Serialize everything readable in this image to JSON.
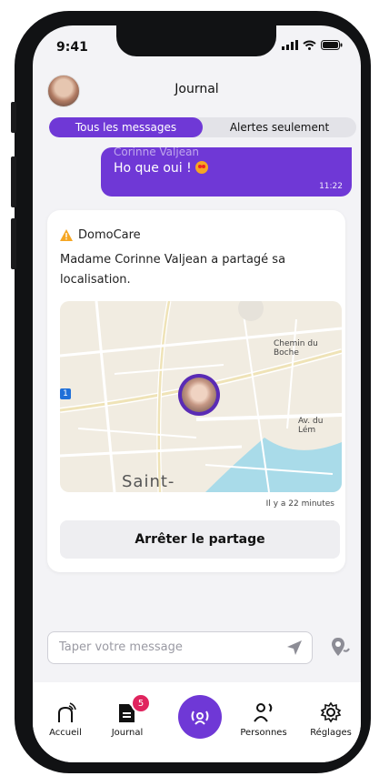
{
  "status": {
    "time": "9:41"
  },
  "header": {
    "title": "Journal"
  },
  "tabs": {
    "all": "Tous les messages",
    "alerts": "Alertes seulement"
  },
  "bubble": {
    "clipped_sender": "Corinne Valjean",
    "text": "Ho que oui !",
    "emoji": "heart-eyes-emoji",
    "time": "11:22"
  },
  "card": {
    "sender": "DomoCare",
    "message": "Madame Corinne Valjean a partagé sa localisation.",
    "time_ago": "Il y a 22 minutes",
    "stop_label": "Arrêter le partage"
  },
  "map": {
    "street_1": "Chemin du Boche",
    "street_2": "Av. du Lém",
    "town": "Saint-",
    "route_badge": "1"
  },
  "composer": {
    "placeholder": "Taper votre message"
  },
  "tabbar": {
    "home": "Accueil",
    "journal": "Journal",
    "journal_badge": "5",
    "people": "Personnes",
    "settings": "Réglages"
  },
  "colors": {
    "accent": "#6f38d6",
    "badge": "#e0245e",
    "warning": "#f5a623"
  }
}
